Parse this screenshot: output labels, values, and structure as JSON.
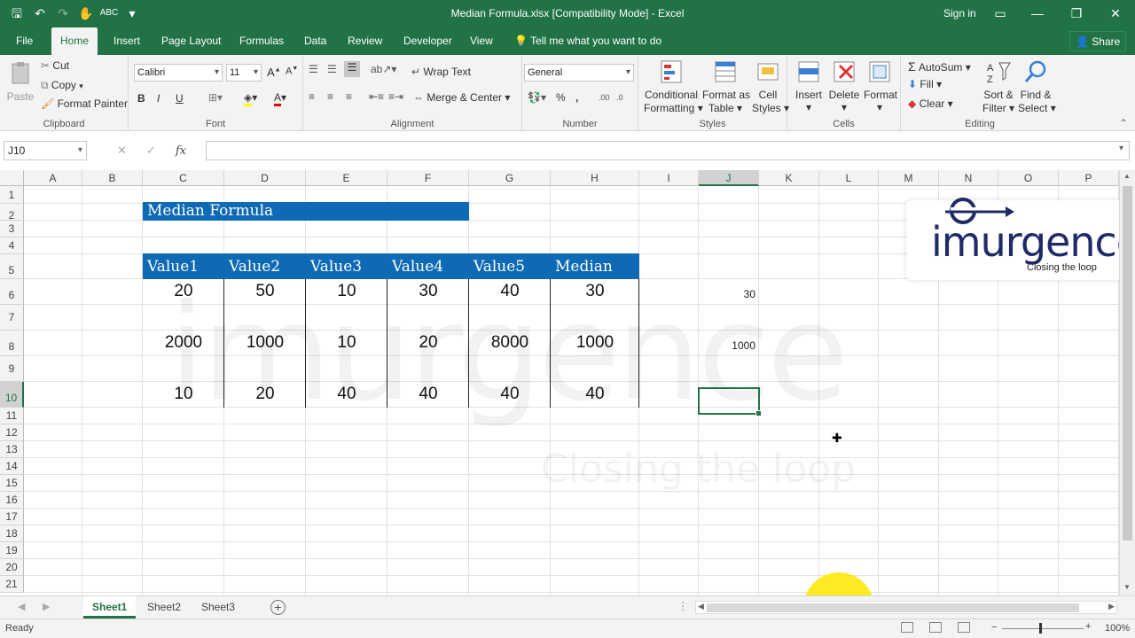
{
  "window": {
    "title": "Median Formula.xlsx  [Compatibility Mode] - Excel",
    "sign_in": "Sign in"
  },
  "ribbon_tabs": [
    "File",
    "Home",
    "Insert",
    "Page Layout",
    "Formulas",
    "Data",
    "Review",
    "Developer",
    "View"
  ],
  "active_tab": "Home",
  "tell_me": "Tell me what you want to do",
  "share": "Share",
  "ribbon": {
    "clipboard": {
      "label": "Clipboard",
      "paste": "Paste",
      "cut": "Cut",
      "copy": "Copy",
      "format_painter": "Format Painter"
    },
    "font": {
      "label": "Font",
      "name": "Calibri",
      "size": "11",
      "bold": "B",
      "italic": "I",
      "underline": "U"
    },
    "alignment": {
      "label": "Alignment",
      "wrap_text": "Wrap Text",
      "merge_center": "Merge & Center"
    },
    "number": {
      "label": "Number",
      "format": "General",
      "percent": "%"
    },
    "styles": {
      "label": "Styles",
      "conditional": "Conditional",
      "conditional2": "Formatting",
      "format_as": "Format as",
      "format_as2": "Table",
      "cell": "Cell",
      "cell2": "Styles"
    },
    "cells": {
      "label": "Cells",
      "insert": "Insert",
      "delete": "Delete",
      "format": "Format"
    },
    "editing": {
      "label": "Editing",
      "autosum": "AutoSum",
      "fill": "Fill",
      "clear": "Clear",
      "sort": "Sort &",
      "sort2": "Filter",
      "find": "Find &",
      "find2": "Select"
    }
  },
  "formula_bar": {
    "name_box": "J10",
    "formula": ""
  },
  "columns": [
    "A",
    "B",
    "C",
    "D",
    "E",
    "F",
    "G",
    "H",
    "I",
    "J",
    "K",
    "L",
    "M",
    "N",
    "O",
    "P"
  ],
  "selected_column": "J",
  "rows": [
    "1",
    "2",
    "3",
    "4",
    "5",
    "6",
    "7",
    "8",
    "9",
    "10",
    "11",
    "12",
    "13",
    "14",
    "15",
    "16",
    "17",
    "18",
    "19",
    "20",
    "21"
  ],
  "selected_row": "10",
  "sheet": {
    "banner_title": "Median Formula",
    "headers": [
      "Value1",
      "Value2",
      "Value3",
      "Value4",
      "Value5",
      "Median"
    ],
    "data_rows": [
      [
        "20",
        "50",
        "10",
        "30",
        "40",
        "30"
      ],
      [
        "2000",
        "1000",
        "10",
        "20",
        "8000",
        "1000"
      ],
      [
        "10",
        "20",
        "40",
        "40",
        "40",
        "40"
      ]
    ],
    "j_values": [
      "30",
      "1000"
    ]
  },
  "logo": {
    "wordmark": "imurgence",
    "tagline": "Closing the loop"
  },
  "watermark": {
    "text": "imurgence",
    "tagline": "Closing the loop"
  },
  "sheet_tabs": [
    "Sheet1",
    "Sheet2",
    "Sheet3"
  ],
  "active_sheet": "Sheet1",
  "status": {
    "ready": "Ready",
    "zoom": "100%"
  },
  "colors": {
    "excel_green": "#217346",
    "banner_blue": "#0e6ab4"
  }
}
